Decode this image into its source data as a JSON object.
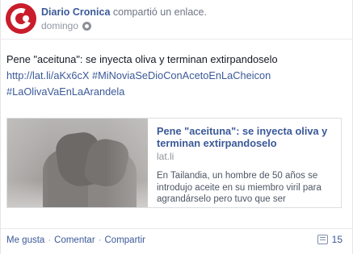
{
  "post": {
    "author": "Diario Cronica",
    "action": "compartió un enlace.",
    "time": "domingo",
    "message_text": "Pene \"aceituna\": se inyecta oliva y terminan extirpandoselo",
    "link_short": "http://lat.li/aKx6cX",
    "hashtag1": "#MiNoviaSeDioConAcetoEnLaCheicon",
    "hashtag2": "#LaOlivaVaEnLaArandela"
  },
  "card": {
    "title": "Pene \"aceituna\": se inyecta oliva y terminan extirpandoselo",
    "domain": "lat.li",
    "description": "En Tailandia, un hombre de 50 años se introdujo aceite en su miembro viril para agrandárselo pero tuvo que ser"
  },
  "footer": {
    "like": "Me gusta",
    "comment": "Comentar",
    "share": "Compartir",
    "comment_count": "15"
  },
  "icons": {
    "avatar": "diario-cronica-logo",
    "privacy": "globe-icon",
    "comments": "comment-icon"
  },
  "colors": {
    "link": "#3b5998",
    "brand_red": "#c91d2b"
  }
}
